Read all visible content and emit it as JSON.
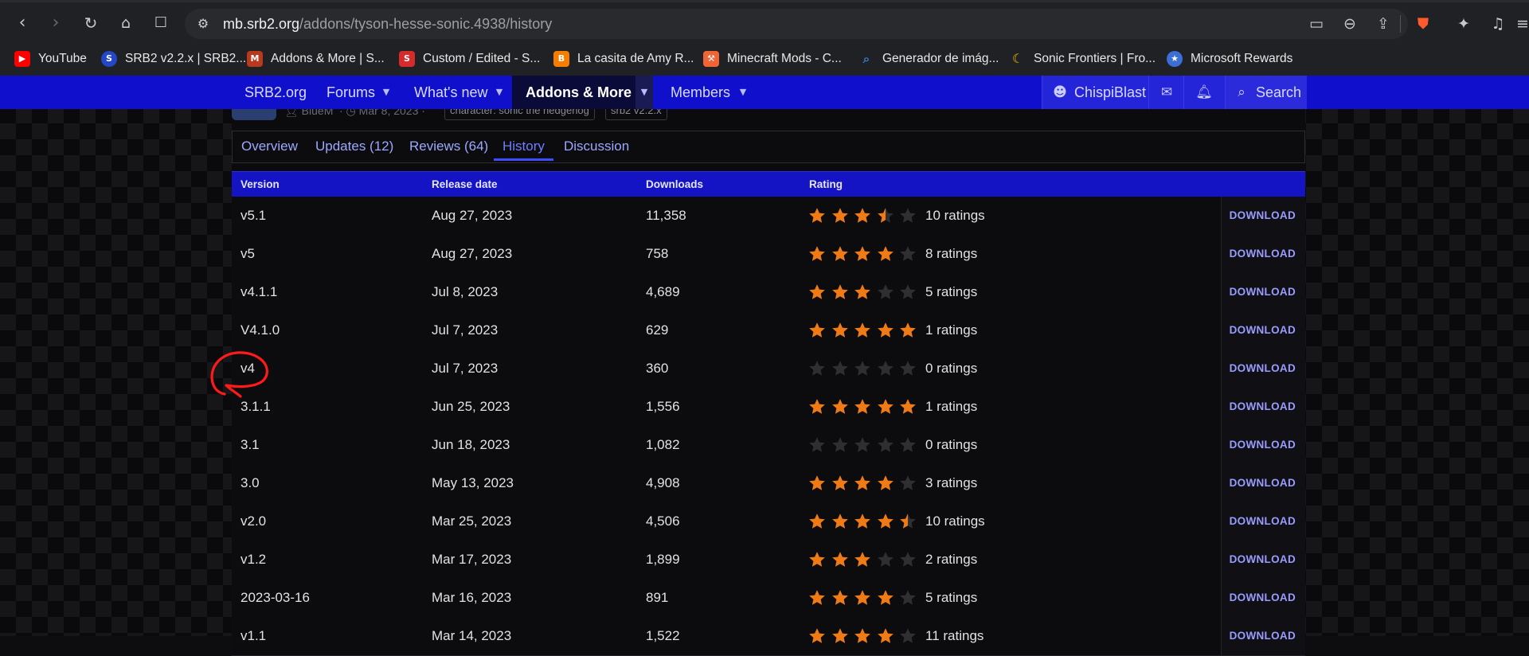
{
  "browser": {
    "url_host": "mb.srb2.org",
    "url_path": "/addons/tyson-hesse-sonic.4938/history"
  },
  "bookmarks": [
    {
      "label": "YouTube",
      "icon": "youtube-icon",
      "color": "#ff0000"
    },
    {
      "label": "SRB2 v2.2.x | SRB2...",
      "icon": "sonic-icon",
      "color": "#2446c8"
    },
    {
      "label": "Addons & More | S...",
      "icon": "mb-icon",
      "color": "#b83a1e"
    },
    {
      "label": "Custom / Edited - S...",
      "icon": "spriters-icon",
      "color": "#d62b2b"
    },
    {
      "label": "La casita de Amy R...",
      "icon": "blogger-icon",
      "color": "#f57d00"
    },
    {
      "label": "Minecraft Mods - C...",
      "icon": "curseforge-icon",
      "color": "#f16436"
    },
    {
      "label": "Generador de imág...",
      "icon": "search-icon",
      "color": "#3a7bd5"
    },
    {
      "label": "Sonic Frontiers | Fro...",
      "icon": "banana-icon",
      "color": "#e6c200"
    },
    {
      "label": "Microsoft Rewards",
      "icon": "medal-icon",
      "color": "#3b6fd6"
    }
  ],
  "site_nav": {
    "items": [
      "SRB2.org",
      "Forums",
      "What's new",
      "Addons & More",
      "Members"
    ],
    "active": "Addons & More",
    "user": "ChispiBlast",
    "search": "Search"
  },
  "resource_meta": {
    "author": "BlueM",
    "date": "Mar 8, 2023",
    "tags": [
      "character: sonic the hedgehog",
      "srb2 v2.2.x"
    ]
  },
  "tabs": [
    "Overview",
    "Updates (12)",
    "Reviews (64)",
    "History",
    "Discussion"
  ],
  "active_tab": "History",
  "table": {
    "headers": [
      "Version",
      "Release date",
      "Downloads",
      "Rating"
    ],
    "download_label": "DOWNLOAD",
    "rows": [
      {
        "version": "v5.1",
        "date": "Aug 27, 2023",
        "downloads": "11,358",
        "stars": 3.5,
        "ratings": "10 ratings"
      },
      {
        "version": "v5",
        "date": "Aug 27, 2023",
        "downloads": "758",
        "stars": 4,
        "ratings": "8 ratings"
      },
      {
        "version": "v4.1.1",
        "date": "Jul 8, 2023",
        "downloads": "4,689",
        "stars": 3,
        "ratings": "5 ratings"
      },
      {
        "version": "V4.1.0",
        "date": "Jul 7, 2023",
        "downloads": "629",
        "stars": 5,
        "ratings": "1 ratings"
      },
      {
        "version": "v4",
        "date": "Jul 7, 2023",
        "downloads": "360",
        "stars": 0,
        "ratings": "0 ratings"
      },
      {
        "version": "3.1.1",
        "date": "Jun 25, 2023",
        "downloads": "1,556",
        "stars": 5,
        "ratings": "1 ratings"
      },
      {
        "version": "3.1",
        "date": "Jun 18, 2023",
        "downloads": "1,082",
        "stars": 0,
        "ratings": "0 ratings"
      },
      {
        "version": "3.0",
        "date": "May 13, 2023",
        "downloads": "4,908",
        "stars": 4,
        "ratings": "3 ratings"
      },
      {
        "version": "v2.0",
        "date": "Mar 25, 2023",
        "downloads": "4,506",
        "stars": 4.5,
        "ratings": "10 ratings"
      },
      {
        "version": "v1.2",
        "date": "Mar 17, 2023",
        "downloads": "1,899",
        "stars": 3,
        "ratings": "2 ratings"
      },
      {
        "version": "2023-03-16",
        "date": "Mar 16, 2023",
        "downloads": "891",
        "stars": 4,
        "ratings": "5 ratings"
      },
      {
        "version": "v1.1",
        "date": "Mar 14, 2023",
        "downloads": "1,522",
        "stars": 4,
        "ratings": "11 ratings"
      }
    ]
  },
  "colors": {
    "nav_blue": "#1010cc",
    "star_filled": "#f07b16",
    "star_empty": "#2e2e33",
    "download_link": "#9a9cff",
    "annotation": "#ff1a1a"
  }
}
